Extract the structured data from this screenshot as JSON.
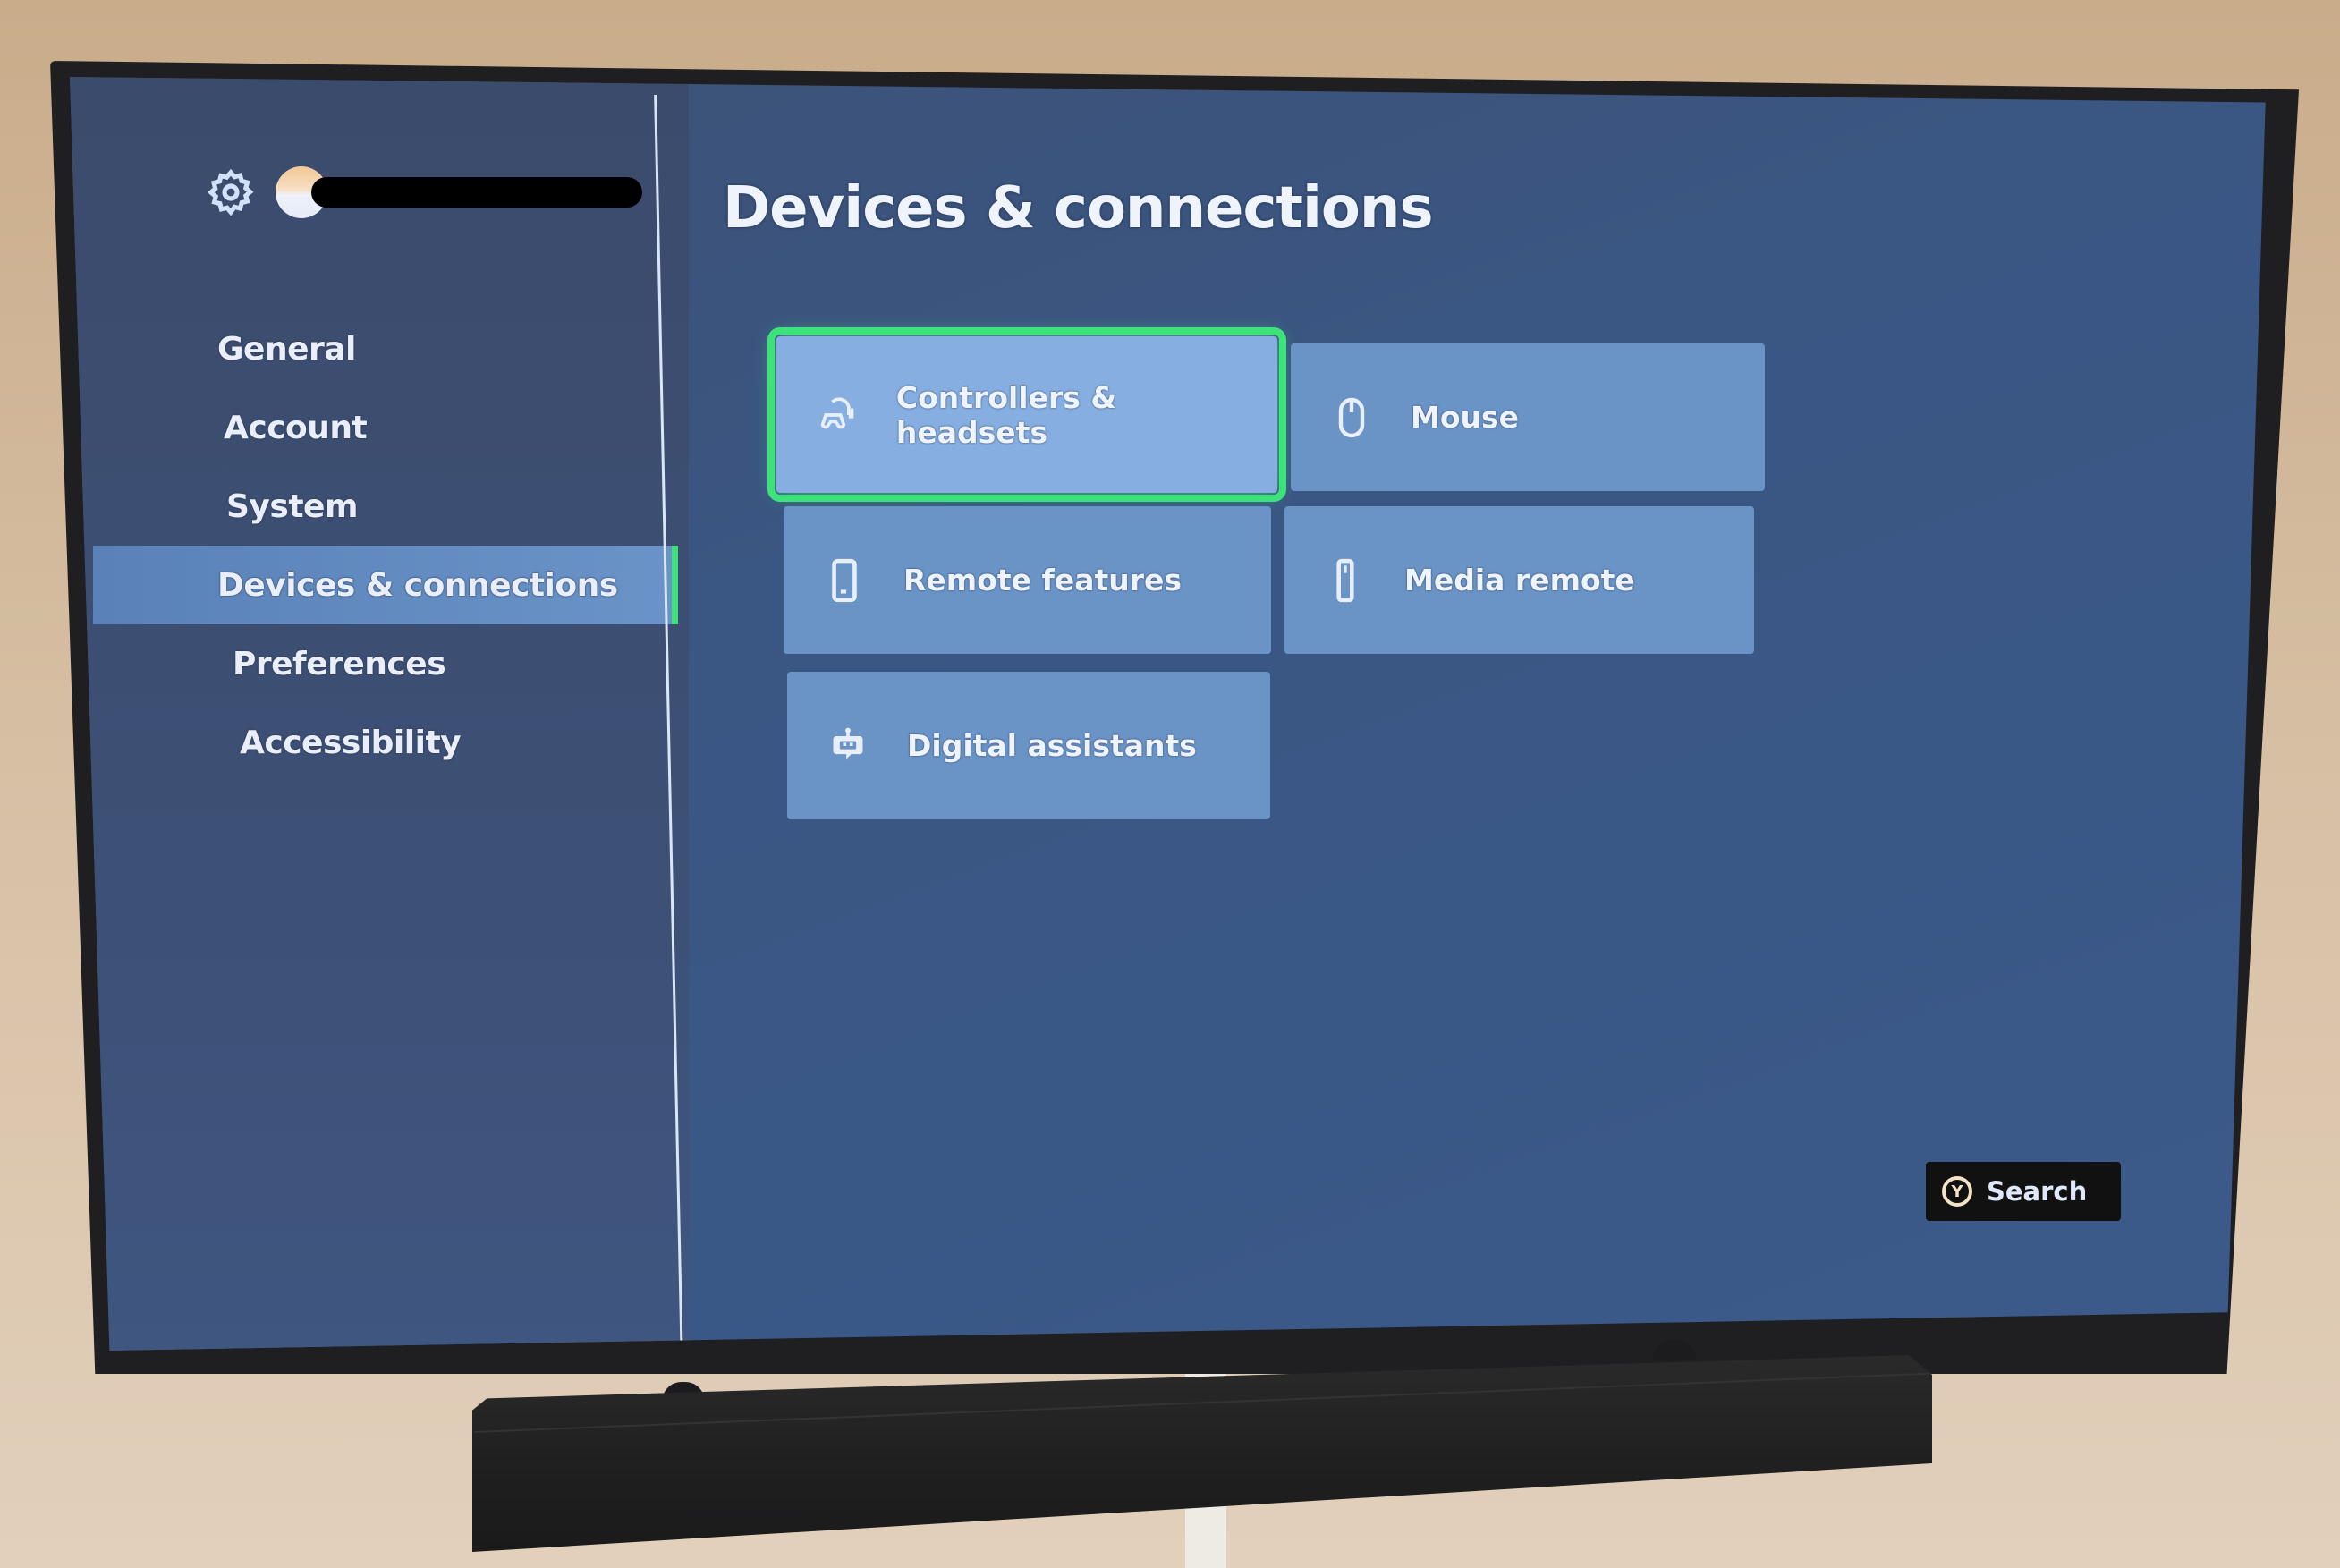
{
  "header": {
    "settings_icon": "gear-icon",
    "profile": {
      "avatar": "avatar-icon",
      "gamertag": ""
    }
  },
  "sidebar": {
    "items": [
      {
        "label": "General",
        "selected": false
      },
      {
        "label": "Account",
        "selected": false
      },
      {
        "label": "System",
        "selected": false
      },
      {
        "label": "Devices & connections",
        "selected": true
      },
      {
        "label": "Preferences",
        "selected": false
      },
      {
        "label": "Accessibility",
        "selected": false
      }
    ]
  },
  "main": {
    "title": "Devices & connections",
    "tiles": [
      {
        "label": "Controllers & headsets",
        "icon": "controller-headset-icon",
        "focused": true
      },
      {
        "label": "Mouse",
        "icon": "mouse-icon",
        "focused": false
      },
      {
        "label": "Remote features",
        "icon": "phone-icon",
        "focused": false
      },
      {
        "label": "Media remote",
        "icon": "remote-icon",
        "focused": false
      },
      {
        "label": "Digital assistants",
        "icon": "robot-assistant-icon",
        "focused": false
      }
    ]
  },
  "footer": {
    "search": {
      "button_glyph": "Y",
      "label": "Search"
    }
  },
  "colors": {
    "focus_accent": "#3de37a",
    "tile": "#6a93c6",
    "tile_focused": "#86aee0",
    "background": "#3b5683"
  }
}
